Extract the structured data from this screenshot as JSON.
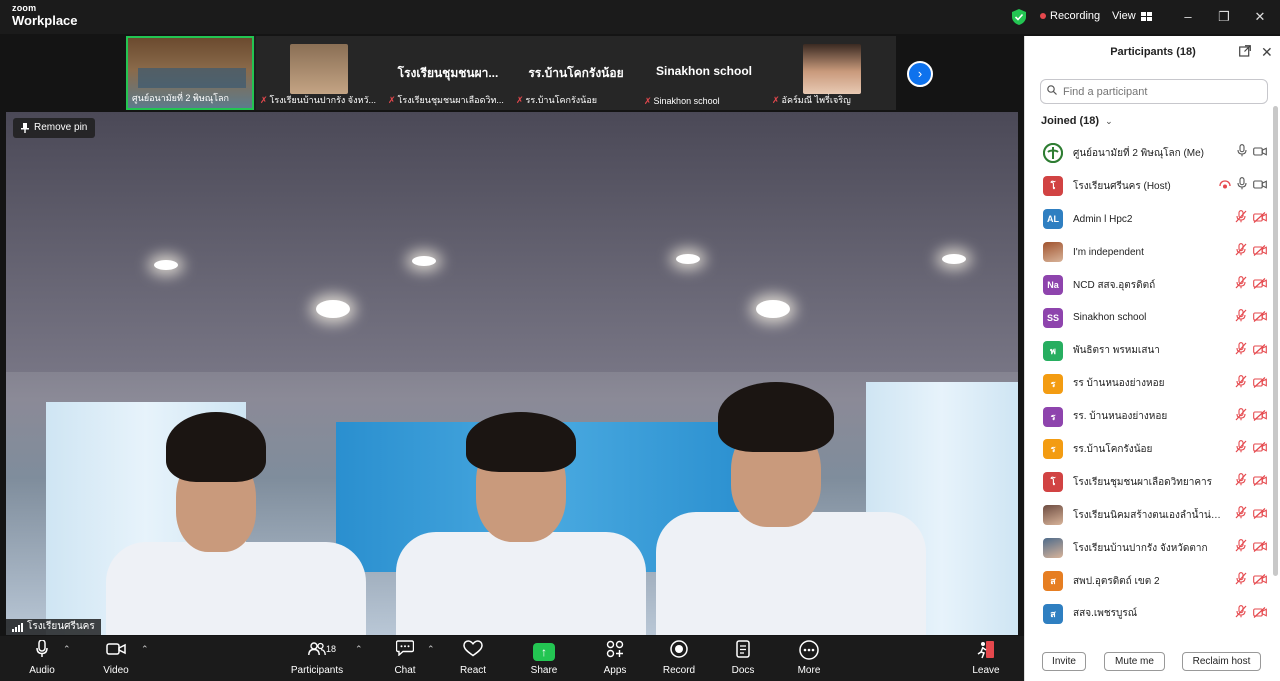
{
  "app": {
    "logo_line1": "zoom",
    "logo_line2": "Workplace",
    "recording_label": "Recording",
    "view_label": "View"
  },
  "thumbnails": [
    {
      "name": "ศูนย์อนามัยที่ 2 พิษณุโลก",
      "type": "video",
      "active": true
    },
    {
      "name": "โรงเรียนบ้านปากรัง จังหวั...",
      "type": "video",
      "active": false
    },
    {
      "name": "โรงเรียนชุมชนผาเลือดวิท...",
      "type": "text",
      "big": "โรงเรียนชุมชนผา...",
      "active": false
    },
    {
      "name": "รร.บ้านโคกรังน้อย",
      "type": "text",
      "big": "รร.บ้านโคกรังน้อย",
      "active": false
    },
    {
      "name": "Sinakhon school",
      "type": "text",
      "big": "Sinakhon school",
      "active": false
    },
    {
      "name": "อัคร์มณี ไพรี่เจริญ",
      "type": "video",
      "active": false
    }
  ],
  "main_video": {
    "remove_pin_label": "Remove pin",
    "speaker_name": "โรงเรียนศรีนคร"
  },
  "toolbar": {
    "audio": "Audio",
    "video": "Video",
    "participants": "Participants",
    "participants_count": "18",
    "chat": "Chat",
    "react": "React",
    "share": "Share",
    "apps": "Apps",
    "record": "Record",
    "docs": "Docs",
    "more": "More",
    "leave": "Leave"
  },
  "panel": {
    "title": "Participants (18)",
    "search_placeholder": "Find a participant",
    "joined_label": "Joined (18)",
    "invite": "Invite",
    "mute": "Mute me",
    "reclaim": "Reclaim host",
    "participants": [
      {
        "name": "ศูนย์อนามัยที่ 2 พิษณุโลก (Me)",
        "initials": "",
        "color": "#2e7d32",
        "avatar": "logo",
        "muted": false
      },
      {
        "name": "โรงเรียนศรีนคร (Host)",
        "initials": "โ",
        "color": "#d14343",
        "avatar": "initials",
        "muted": false,
        "recording": true
      },
      {
        "name": "Admin l Hpc2",
        "initials": "AL",
        "color": "#2f7fc1",
        "avatar": "initials",
        "muted": true
      },
      {
        "name": "I'm independent",
        "initials": "",
        "color": "#a0522d",
        "avatar": "photo",
        "muted": true
      },
      {
        "name": "NCD สสจ.อุตรดิตถ์",
        "initials": "Na",
        "color": "#8e44ad",
        "avatar": "initials",
        "muted": true
      },
      {
        "name": "Sinakhon school",
        "initials": "SS",
        "color": "#8e44ad",
        "avatar": "initials",
        "muted": true
      },
      {
        "name": "พันธิตรา พรหมเสนา",
        "initials": "พ",
        "color": "#27ae60",
        "avatar": "initials",
        "muted": true
      },
      {
        "name": "รร บ้านหนองย่างหอย",
        "initials": "ร",
        "color": "#f39c12",
        "avatar": "initials",
        "muted": true
      },
      {
        "name": "รร. บ้านหนองย่างหอย",
        "initials": "ร",
        "color": "#8e44ad",
        "avatar": "initials",
        "muted": true
      },
      {
        "name": "รร.บ้านโคกรังน้อย",
        "initials": "ร",
        "color": "#f39c12",
        "avatar": "initials",
        "muted": true
      },
      {
        "name": "โรงเรียนชุมชนผาเลือดวิทยาคาร",
        "initials": "โ",
        "color": "#d14343",
        "avatar": "initials",
        "muted": true
      },
      {
        "name": "โรงเรียนนิคมสร้างตนเองลำน้ำน่านสง...",
        "initials": "",
        "color": "#6d4c41",
        "avatar": "photo",
        "muted": true
      },
      {
        "name": "โรงเรียนบ้านปากรัง จังหวัดตาก",
        "initials": "",
        "color": "#4e6b8a",
        "avatar": "photo",
        "muted": true
      },
      {
        "name": "สพป.อุตรดิตถ์ เขต 2",
        "initials": "ส",
        "color": "#e67e22",
        "avatar": "initials",
        "muted": true
      },
      {
        "name": "สสจ.เพชรบูรณ์",
        "initials": "ส",
        "color": "#2f7fc1",
        "avatar": "initials",
        "muted": true
      }
    ]
  },
  "colors": {
    "accent": "#0e72ed",
    "active_green": "#23c552",
    "muted_red": "#e5484d"
  }
}
